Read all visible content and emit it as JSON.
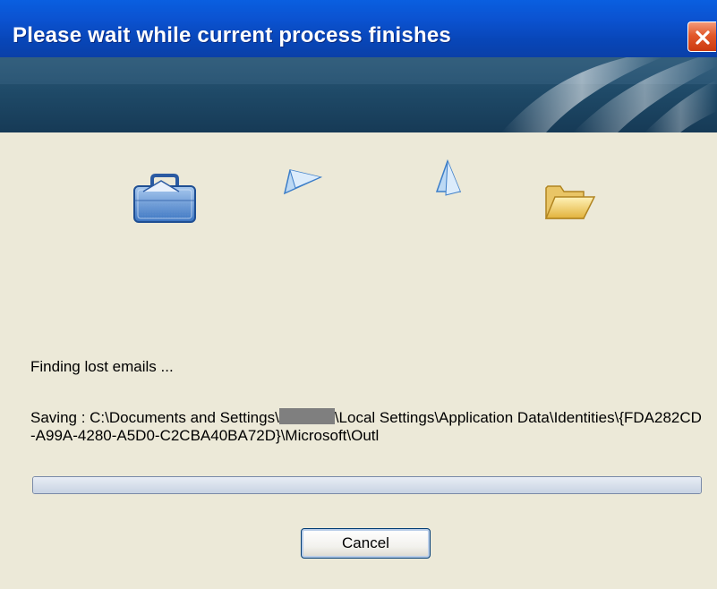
{
  "window": {
    "title": "Please wait while current process finishes",
    "close_icon": "close-icon"
  },
  "animation": {
    "icons": [
      "briefcase-icon",
      "paper-airplane-icon",
      "paper-airplane-icon",
      "folder-icon"
    ]
  },
  "status": {
    "label": "Finding lost emails ..."
  },
  "path": {
    "prefix": "Saving : C:\\Documents and Settings\\",
    "suffix": "\\Local Settings\\Application Data\\Identities\\{FDA282CD-A99A-4280-A5D0-C2CBA40BA72D}\\Microsoft\\Outl"
  },
  "progress": {
    "value_percent": 0
  },
  "buttons": {
    "cancel_label": "Cancel"
  },
  "colors": {
    "titlebar": "#0b52d0",
    "background": "#ece9d8",
    "close": "#e2582a"
  }
}
